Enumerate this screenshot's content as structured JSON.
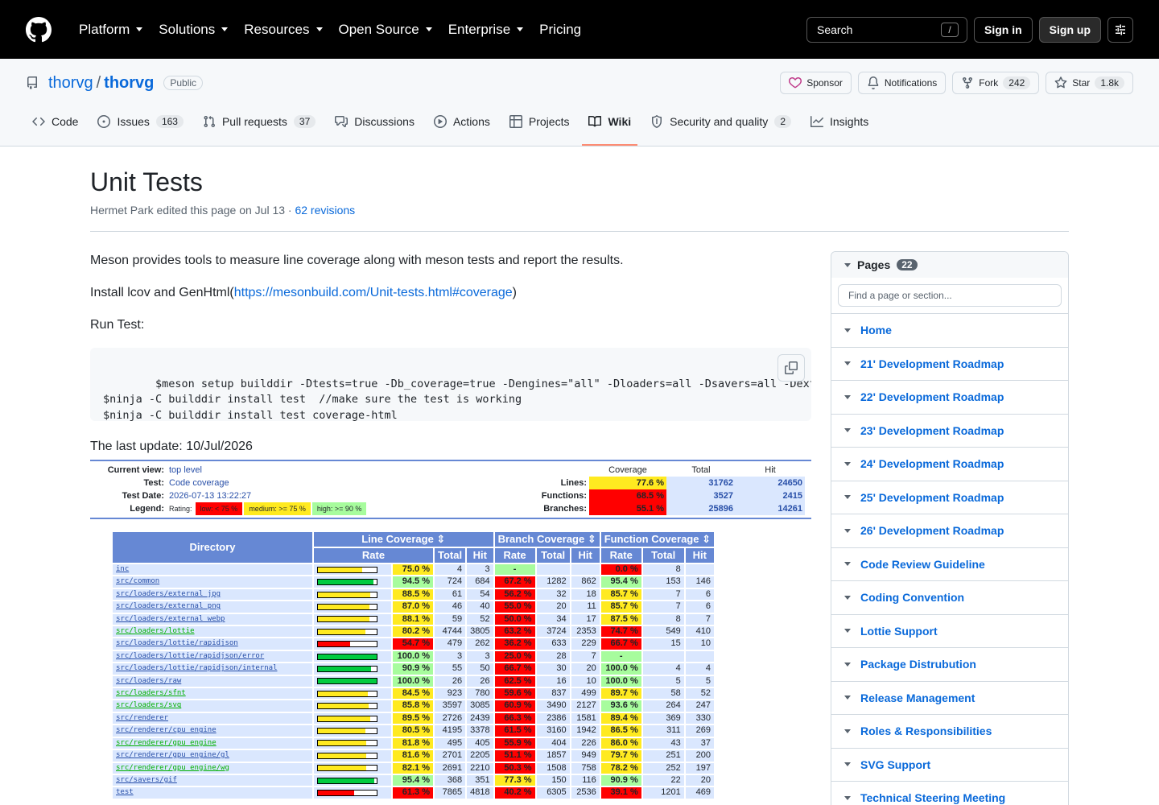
{
  "header": {
    "nav": [
      "Platform",
      "Solutions",
      "Resources",
      "Open Source",
      "Enterprise",
      "Pricing"
    ],
    "search_label": "Search",
    "search_key": "/",
    "sign_in": "Sign in",
    "sign_up": "Sign up"
  },
  "repo": {
    "owner": "thorvg",
    "sep": "/",
    "name": "thorvg",
    "visibility": "Public",
    "sponsor": "Sponsor",
    "notifications": "Notifications",
    "fork": "Fork",
    "fork_count": "242",
    "star": "Star",
    "star_count": "1.8k",
    "tabs": [
      {
        "label": "Code",
        "count": ""
      },
      {
        "label": "Issues",
        "count": "163"
      },
      {
        "label": "Pull requests",
        "count": "37"
      },
      {
        "label": "Discussions",
        "count": ""
      },
      {
        "label": "Actions",
        "count": ""
      },
      {
        "label": "Projects",
        "count": ""
      },
      {
        "label": "Wiki",
        "count": ""
      },
      {
        "label": "Security and quality",
        "count": "2"
      },
      {
        "label": "Insights",
        "count": ""
      }
    ]
  },
  "page": {
    "title": "Unit Tests",
    "meta_prefix": "Hermet Park edited this page on Jul 13 · ",
    "revisions": "62 revisions",
    "p1": "Meson provides tools to measure line coverage along with meson tests and report the results.",
    "p2_prefix": "Install lcov and GenHtml(",
    "p2_link": "https://mesonbuild.com/Unit-tests.html#coverage",
    "p2_suffix": ")",
    "p3": "Run Test:",
    "code": "$meson setup builddir -Dtests=true -Db_coverage=true -Dengines=\"all\" -Dloaders=all -Dsavers=all -Dextra\n$ninja -C builddir install test  //make sure the test is working\n$ninja -C builddir install test coverage-html",
    "last_update": "The last update: 10/Jul/2026"
  },
  "lcov": {
    "current_view_k": "Current view:",
    "current_view_v": "top level",
    "test_k": "Test:",
    "test_v": "Code coverage",
    "date_k": "Test Date:",
    "date_v": "2026-07-13 13:22:27",
    "legend_k": "Legend:",
    "legend_rating": "Rating:",
    "legend_low": "low: < 75 %",
    "legend_med": "medium: >= 75 %",
    "legend_high": "high: >= 90 %",
    "summary_headers": [
      "Coverage",
      "Total",
      "Hit"
    ],
    "summary": [
      {
        "label": "Lines:",
        "cov": "77.6 %",
        "total": "31762",
        "hit": "24650",
        "color": "#ffea20"
      },
      {
        "label": "Functions:",
        "cov": "68.5 %",
        "total": "3527",
        "hit": "2415",
        "color": "#ff0000"
      },
      {
        "label": "Branches:",
        "cov": "55.1 %",
        "total": "25896",
        "hit": "14261",
        "color": "#ff0000"
      }
    ],
    "table_headers": {
      "directory": "Directory",
      "line": "Line Coverage ⇕",
      "branch": "Branch Coverage ⇕",
      "function": "Function Coverage ⇕",
      "rate": "Rate",
      "total": "Total",
      "hit": "Hit"
    },
    "rows": [
      {
        "dir": "inc",
        "dc": "#284fa8",
        "pct": 75.0,
        "l": "75.0 %",
        "lt": "4",
        "lh": "3",
        "b": "-",
        "bt": "",
        "bh": "",
        "f": "0.0 %",
        "ft": "8",
        "fh": ""
      },
      {
        "dir": "src/common",
        "dc": "#284fa8",
        "pct": 94.5,
        "l": "94.5 %",
        "lt": "724",
        "lh": "684",
        "b": "67.2 %",
        "bt": "1282",
        "bh": "862",
        "f": "95.4 %",
        "ft": "153",
        "fh": "146"
      },
      {
        "dir": "src/loaders/external_jpg",
        "dc": "#284fa8",
        "pct": 88.5,
        "l": "88.5 %",
        "lt": "61",
        "lh": "54",
        "b": "56.2 %",
        "bt": "32",
        "bh": "18",
        "f": "85.7 %",
        "ft": "7",
        "fh": "6"
      },
      {
        "dir": "src/loaders/external_png",
        "dc": "#284fa8",
        "pct": 87.0,
        "l": "87.0 %",
        "lt": "46",
        "lh": "40",
        "b": "55.0 %",
        "bt": "20",
        "bh": "11",
        "f": "85.7 %",
        "ft": "7",
        "fh": "6"
      },
      {
        "dir": "src/loaders/external_webp",
        "dc": "#284fa8",
        "pct": 88.1,
        "l": "88.1 %",
        "lt": "59",
        "lh": "52",
        "b": "50.0 %",
        "bt": "34",
        "bh": "17",
        "f": "87.5 %",
        "ft": "8",
        "fh": "7"
      },
      {
        "dir": "src/loaders/lottie",
        "dc": "#00b000",
        "pct": 80.2,
        "l": "80.2 %",
        "lt": "4744",
        "lh": "3805",
        "b": "63.2 %",
        "bt": "3724",
        "bh": "2353",
        "f": "74.7 %",
        "ft": "549",
        "fh": "410"
      },
      {
        "dir": "src/loaders/lottie/rapidjson",
        "dc": "#284fa8",
        "pct": 54.7,
        "l": "54.7 %",
        "lt": "479",
        "lh": "262",
        "b": "36.2 %",
        "bt": "633",
        "bh": "229",
        "f": "66.7 %",
        "ft": "15",
        "fh": "10"
      },
      {
        "dir": "src/loaders/lottie/rapidjson/error",
        "dc": "#284fa8",
        "pct": 100.0,
        "l": "100.0 %",
        "lt": "3",
        "lh": "3",
        "b": "25.0 %",
        "bt": "28",
        "bh": "7",
        "f": "-",
        "ft": "",
        "fh": ""
      },
      {
        "dir": "src/loaders/lottie/rapidjson/internal",
        "dc": "#284fa8",
        "pct": 90.9,
        "l": "90.9 %",
        "lt": "55",
        "lh": "50",
        "b": "66.7 %",
        "bt": "30",
        "bh": "20",
        "f": "100.0 %",
        "ft": "4",
        "fh": "4"
      },
      {
        "dir": "src/loaders/raw",
        "dc": "#284fa8",
        "pct": 100.0,
        "l": "100.0 %",
        "lt": "26",
        "lh": "26",
        "b": "62.5 %",
        "bt": "16",
        "bh": "10",
        "f": "100.0 %",
        "ft": "5",
        "fh": "5"
      },
      {
        "dir": "src/loaders/sfnt",
        "dc": "#00b000",
        "pct": 84.5,
        "l": "84.5 %",
        "lt": "923",
        "lh": "780",
        "b": "59.6 %",
        "bt": "837",
        "bh": "499",
        "f": "89.7 %",
        "ft": "58",
        "fh": "52"
      },
      {
        "dir": "src/loaders/svg",
        "dc": "#00b000",
        "pct": 85.8,
        "l": "85.8 %",
        "lt": "3597",
        "lh": "3085",
        "b": "60.9 %",
        "bt": "3490",
        "bh": "2127",
        "f": "93.6 %",
        "ft": "264",
        "fh": "247"
      },
      {
        "dir": "src/renderer",
        "dc": "#284fa8",
        "pct": 89.5,
        "l": "89.5 %",
        "lt": "2726",
        "lh": "2439",
        "b": "66.3 %",
        "bt": "2386",
        "bh": "1581",
        "f": "89.4 %",
        "ft": "369",
        "fh": "330"
      },
      {
        "dir": "src/renderer/cpu_engine",
        "dc": "#284fa8",
        "pct": 80.5,
        "l": "80.5 %",
        "lt": "4195",
        "lh": "3378",
        "b": "61.5 %",
        "bt": "3160",
        "bh": "1942",
        "f": "86.5 %",
        "ft": "311",
        "fh": "269"
      },
      {
        "dir": "src/renderer/gpu_engine",
        "dc": "#00b000",
        "pct": 81.8,
        "l": "81.8 %",
        "lt": "495",
        "lh": "405",
        "b": "55.9 %",
        "bt": "404",
        "bh": "226",
        "f": "86.0 %",
        "ft": "43",
        "fh": "37"
      },
      {
        "dir": "src/renderer/gpu_engine/gl",
        "dc": "#284fa8",
        "pct": 81.6,
        "l": "81.6 %",
        "lt": "2701",
        "lh": "2205",
        "b": "51.1 %",
        "bt": "1857",
        "bh": "949",
        "f": "79.7 %",
        "ft": "251",
        "fh": "200"
      },
      {
        "dir": "src/renderer/gpu_engine/wg",
        "dc": "#00b000",
        "pct": 82.1,
        "l": "82.1 %",
        "lt": "2691",
        "lh": "2210",
        "b": "50.3 %",
        "bt": "1508",
        "bh": "758",
        "f": "78.2 %",
        "ft": "252",
        "fh": "197"
      },
      {
        "dir": "src/savers/gif",
        "dc": "#284fa8",
        "pct": 95.4,
        "l": "95.4 %",
        "lt": "368",
        "lh": "351",
        "b": "77.3 %",
        "bt": "150",
        "bh": "116",
        "f": "90.9 %",
        "ft": "22",
        "fh": "20"
      },
      {
        "dir": "test",
        "dc": "#284fa8",
        "pct": 61.3,
        "l": "61.3 %",
        "lt": "7865",
        "lh": "4818",
        "b": "40.2 %",
        "bt": "6305",
        "bh": "2536",
        "f": "39.1 %",
        "ft": "1201",
        "fh": "469"
      }
    ]
  },
  "sidebar": {
    "title": "Pages",
    "count": "22",
    "find_placeholder": "Find a page or section...",
    "items": [
      "Home",
      "21' Development Roadmap",
      "22' Development Roadmap",
      "23' Development Roadmap",
      "24' Development Roadmap",
      "25' Development Roadmap",
      "26' Development Roadmap",
      "Code Review Guideline",
      "Coding Convention",
      "Lottie Support",
      "Package Distrubution",
      "Release Management",
      "Roles & Responsibilities",
      "SVG Support",
      "Technical Steering Meeting"
    ]
  }
}
